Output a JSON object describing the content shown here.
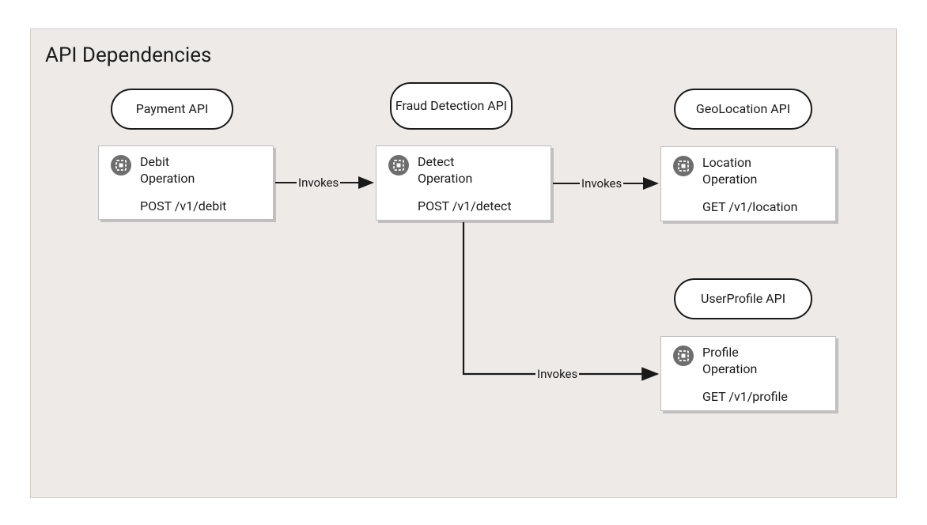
{
  "title": "API Dependencies",
  "pills": {
    "payment": "Payment API",
    "fraud": "Fraud Detection API",
    "geo": "GeoLocation API",
    "profile": "UserProfile API"
  },
  "ops": {
    "debit": {
      "name": "Debit Operation",
      "path": "POST /v1/debit"
    },
    "detect": {
      "name": "Detect Operation",
      "path": "POST /v1/detect"
    },
    "location": {
      "name": "Location Operation",
      "path": "GET /v1/location"
    },
    "profile": {
      "name": "Profile Operation",
      "path": "GET /v1/profile"
    }
  },
  "edges": {
    "e1": "Invokes",
    "e2": "Invokes",
    "e3": "Invokes"
  }
}
